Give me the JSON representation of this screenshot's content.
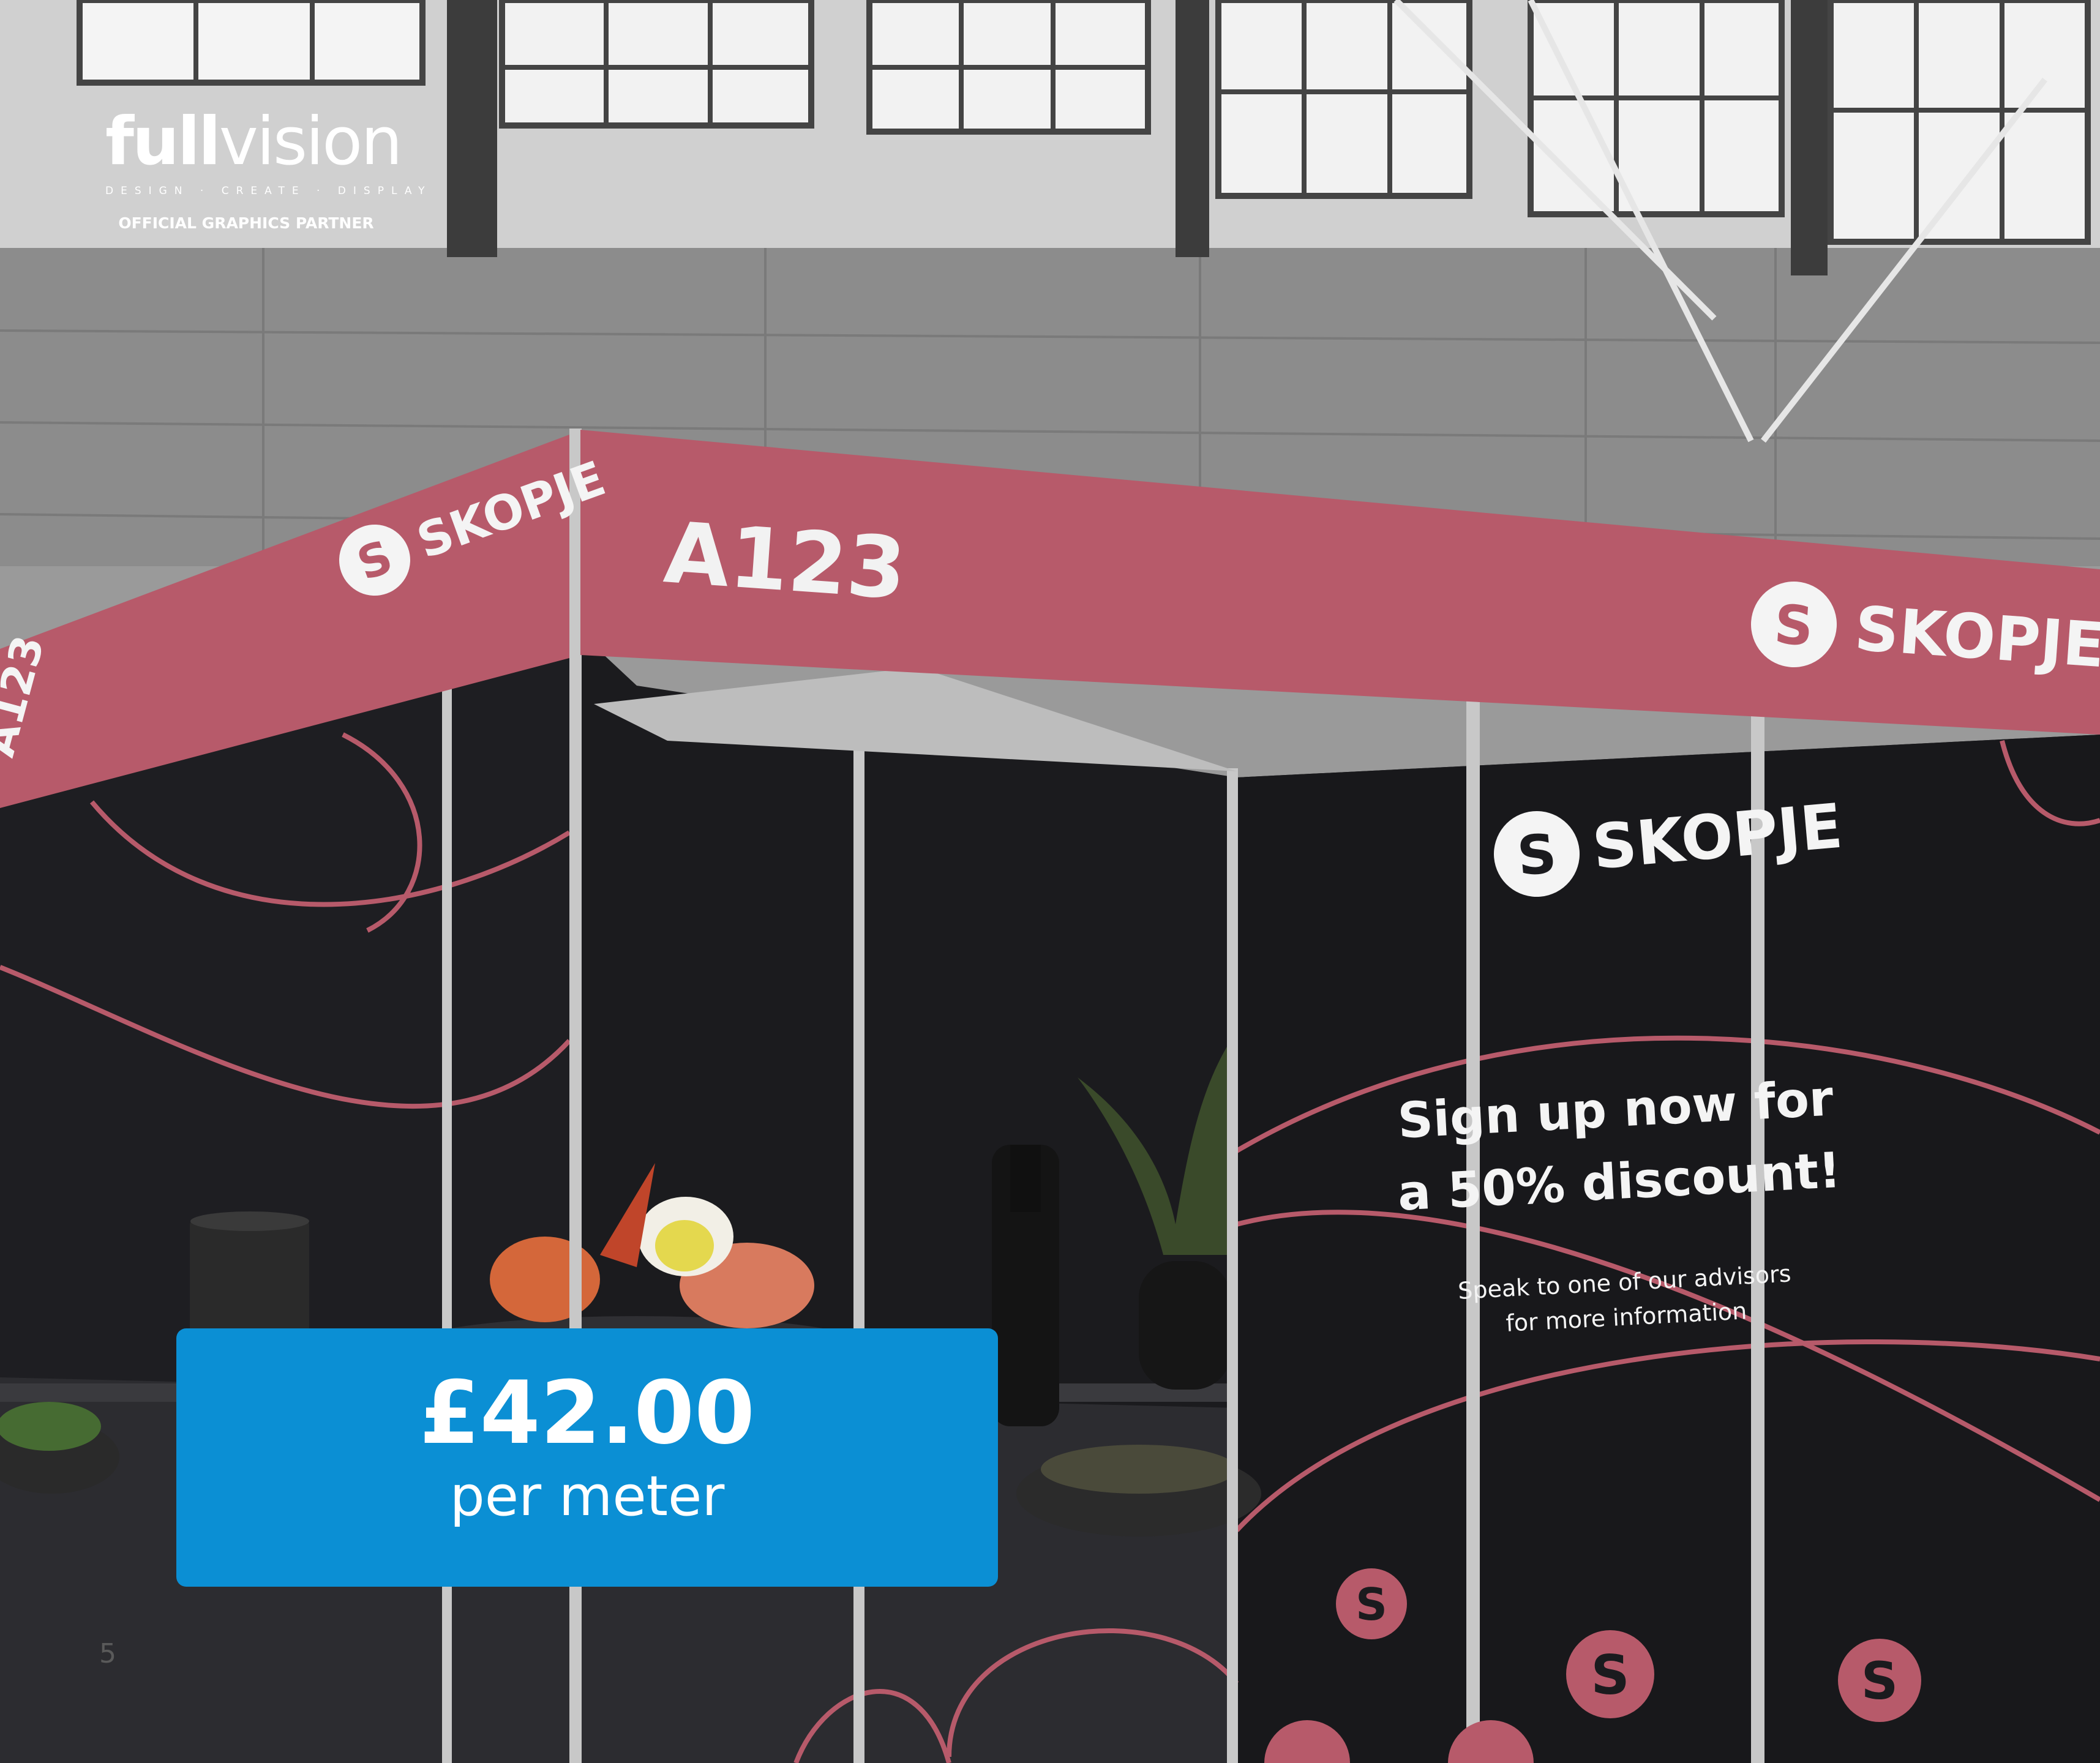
{
  "logo": {
    "brand_bold": "full",
    "brand_light": "vision",
    "tagline": "DESIGN · CREATE · DISPLAY",
    "partner_text": "OFFICIAL GRAPHICS PARTNER"
  },
  "booth": {
    "stand_number": "A123",
    "brand_name": "SKOPJE",
    "brand_initial": "S",
    "promo_line_1": "Sign up now for",
    "promo_line_2": "a 50% discount!",
    "promo_sub_1": "Speak to one of our advisors",
    "promo_sub_2": "for more information"
  },
  "price": {
    "amount": "£42.00",
    "unit": "per meter"
  },
  "page": {
    "number": "5"
  },
  "colors": {
    "brand_pink": "#b75a6a",
    "price_blue": "#0b8fd4",
    "panel_dark": "#1b1b1e"
  }
}
